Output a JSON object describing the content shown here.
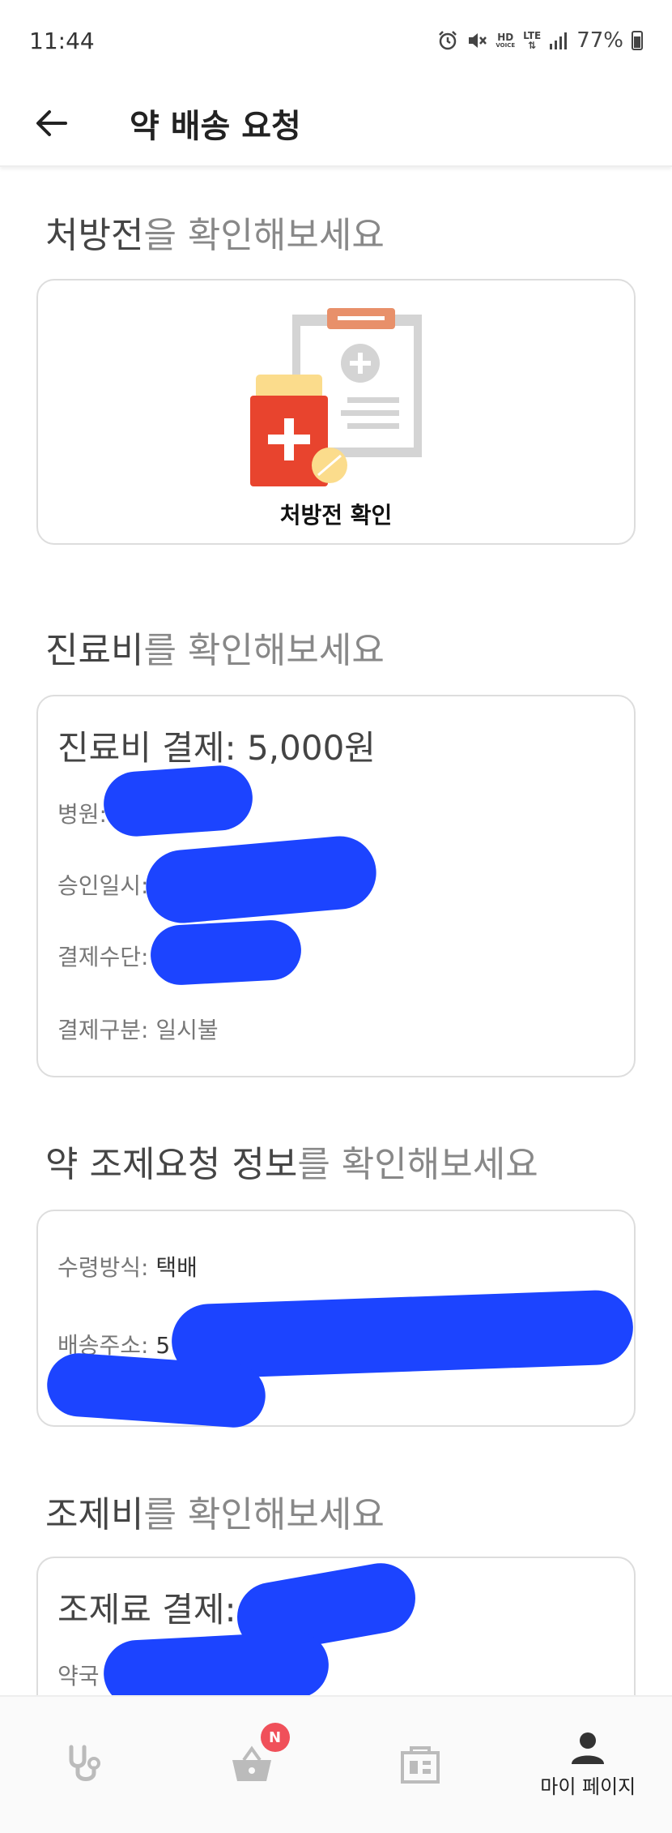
{
  "status_bar": {
    "time": "11:44",
    "hd": "HD",
    "voice": "VOICE",
    "lte": "LTE",
    "battery": "77%"
  },
  "app_bar": {
    "title": "약 배송 요청"
  },
  "prescription": {
    "heading_strong": "처방전",
    "heading_rest": "을 확인해보세요",
    "card_label": "처방전 확인"
  },
  "fee": {
    "heading_strong": "진료비",
    "heading_rest": "를 확인해보세요",
    "title_label": "진료비 결제:",
    "title_value": "5,000원",
    "hospital_label": "병원:",
    "approval_label": "승인일시:",
    "method_label": "결제수단:",
    "type_label": "결제구분:",
    "type_value": "일시불"
  },
  "prep": {
    "heading_strong": "약 조제요청 정보",
    "heading_rest": "를 확인해보세요",
    "receive_label": "수령방식:",
    "receive_value": "택배",
    "address_label": "배송주소:",
    "address_value": "5"
  },
  "prep_fee": {
    "heading_strong": "조제비",
    "heading_rest": "를 확인해보세요",
    "title_label": "조제료 결제:",
    "pharmacy_label": "약국"
  },
  "bottom_nav": {
    "items": [
      {
        "icon": "stethoscope-icon",
        "label": ""
      },
      {
        "icon": "basket-icon",
        "label": "",
        "badge": "N"
      },
      {
        "icon": "news-icon",
        "label": ""
      },
      {
        "icon": "person-icon",
        "label": "마이 페이지"
      }
    ]
  },
  "colors": {
    "accent_badge": "#f0505a",
    "redaction": "#1c44ff",
    "heading_grey": "#888888"
  }
}
